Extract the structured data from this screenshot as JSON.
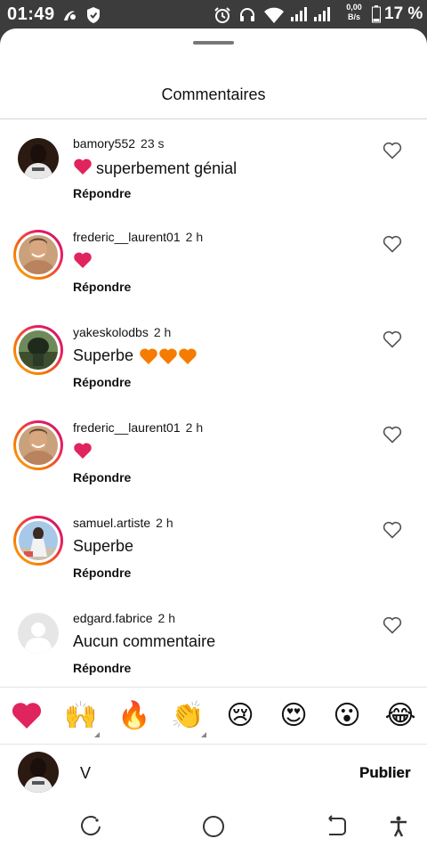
{
  "status_bar": {
    "time": "01:49",
    "net_speed_value": "0,00",
    "net_speed_unit": "B/s",
    "battery": "17 %"
  },
  "sheet": {
    "title": "Commentaires"
  },
  "comments": [
    {
      "username": "bamory552",
      "time": "23 s",
      "text": "superbement génial",
      "emoji_prefix": "heart",
      "reply": "Répondre",
      "avatar": "dark-person",
      "ring": false
    },
    {
      "username": "frederic__laurent01",
      "time": "2 h",
      "text": "",
      "emoji_prefix": "heart",
      "reply": "Répondre",
      "avatar": "smiling-man",
      "ring": true
    },
    {
      "username": "yakeskolodbs",
      "time": "2 h",
      "text": "Superbe",
      "emoji_suffix": "orange-hearts-3",
      "reply": "Répondre",
      "avatar": "green-photo",
      "ring": true
    },
    {
      "username": "frederic__laurent01",
      "time": "2 h",
      "text": "",
      "emoji_prefix": "heart",
      "reply": "Répondre",
      "avatar": "smiling-man",
      "ring": true
    },
    {
      "username": "samuel.artiste",
      "time": "2 h",
      "text": "Superbe",
      "reply": "Répondre",
      "avatar": "blue-sky-person",
      "ring": true
    },
    {
      "username": "edgard.fabrice",
      "time": "2 h",
      "text": "Aucun commentaire",
      "reply": "Répondre",
      "avatar": "default-avatar",
      "ring": false
    }
  ],
  "emoji_bar": [
    "❤️",
    "🙌",
    "🔥",
    "👏",
    "😢",
    "😍",
    "😮",
    "😂"
  ],
  "composer": {
    "value": "V",
    "publish_label": "Publier"
  },
  "colors": {
    "heart_red": "#e0245e",
    "ring_orange": "#f57c00",
    "ring_pink": "#e91e63"
  }
}
